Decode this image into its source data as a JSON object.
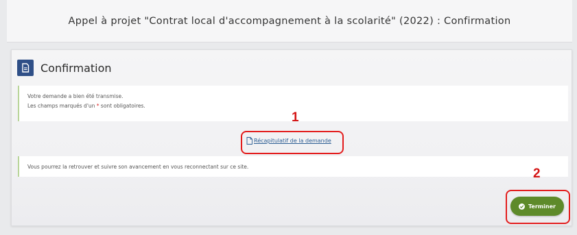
{
  "header": {
    "title": "Appel à projet \"Contrat local d'accompagnement à la scolarité\" (2022) : Confirmation"
  },
  "card": {
    "title": "Confirmation",
    "icon": "document-icon",
    "accent_color": "#2f4f87"
  },
  "info": {
    "line1": "Votre demande a bien été transmise.",
    "line2_prefix": "Les champs marqués d'un ",
    "required_mark": "*",
    "line2_suffix": " sont obligatoires."
  },
  "recap_link": {
    "label": "Récapitulatif de la demande",
    "icon": "pdf-file-icon"
  },
  "follow_text": "Vous pourrez la retrouver et suivre son avancement en vous reconnectant sur ce site.",
  "finish_button": {
    "label": "Terminer",
    "icon": "check-circle-icon",
    "color": "#5e8a2a"
  },
  "callouts": [
    {
      "number": "1"
    },
    {
      "number": "2"
    }
  ],
  "callout_color": "#e31c1c"
}
